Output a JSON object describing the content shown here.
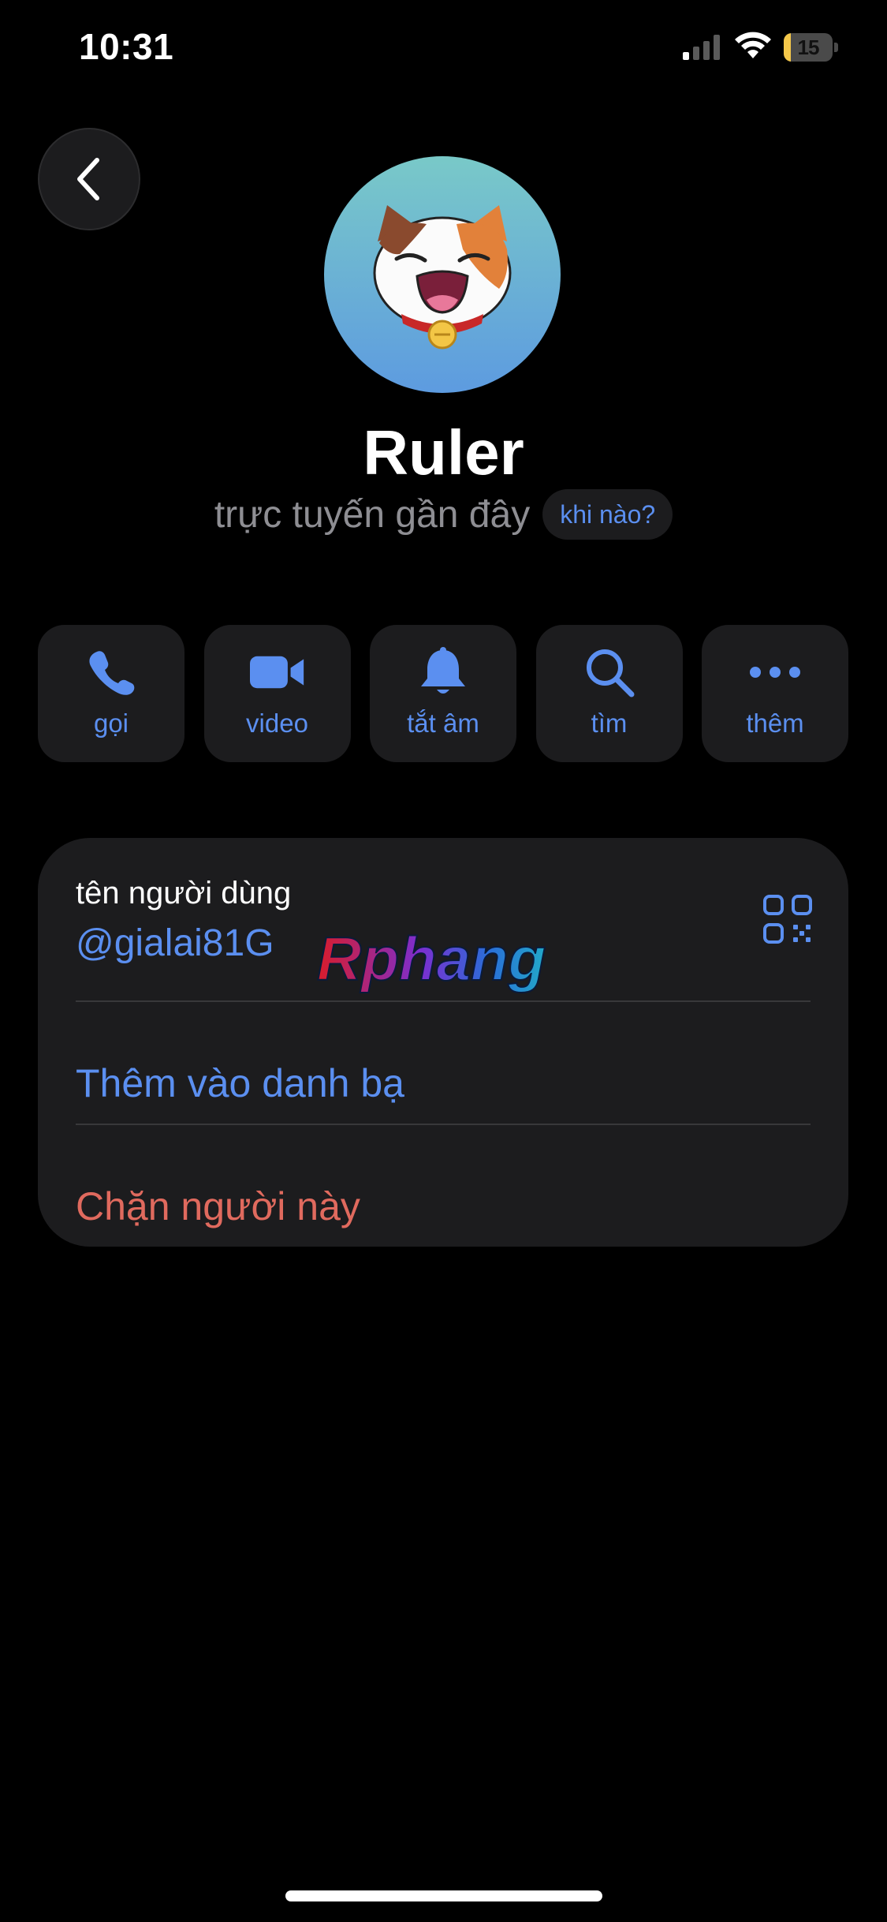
{
  "status_bar": {
    "time": "10:31",
    "battery_percent": "15",
    "battery_level": 0.15
  },
  "profile": {
    "name": "Ruler",
    "status": "trực tuyến gần đây",
    "when_label": "khi nào?"
  },
  "actions": [
    {
      "label": "gọi",
      "icon": "phone-icon"
    },
    {
      "label": "video",
      "icon": "video-camera-icon"
    },
    {
      "label": "tắt âm",
      "icon": "bell-icon"
    },
    {
      "label": "tìm",
      "icon": "search-icon"
    },
    {
      "label": "thêm",
      "icon": "more-icon"
    }
  ],
  "info": {
    "username_label": "tên người dùng",
    "username": "@gialai81G",
    "watermark": "Rphang",
    "add_contact": "Thêm vào danh bạ",
    "block_user": "Chặn người này"
  },
  "colors": {
    "accent": "#5b8ff0",
    "danger": "#e06a5e",
    "background": "#000000",
    "card": "#1c1c1e"
  }
}
